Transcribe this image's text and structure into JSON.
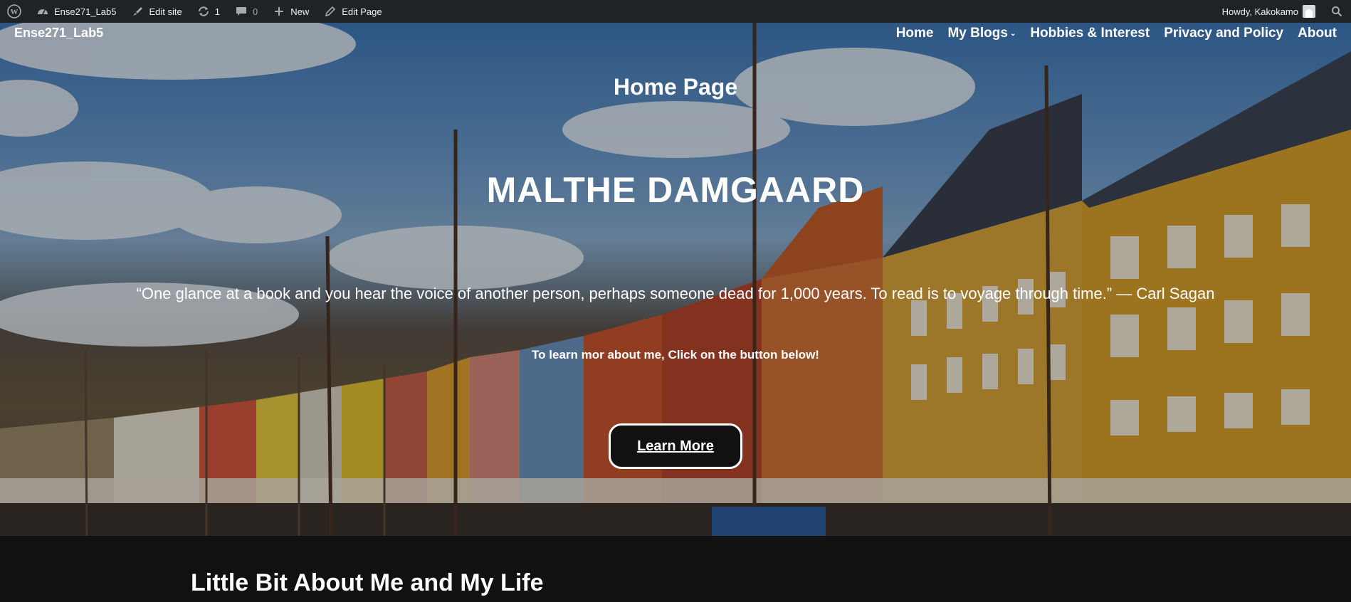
{
  "adminbar": {
    "site_name": "Ense271_Lab5",
    "edit_site": "Edit site",
    "updates_count": "1",
    "comments_count": "0",
    "new_label": "New",
    "edit_page": "Edit Page",
    "howdy": "Howdy, Kakokamo",
    "bg_color": "#1d2327"
  },
  "header": {
    "site_title": "Ense271_Lab5",
    "nav": [
      "Home",
      "My Blogs",
      "Hobbies & Interest",
      "Privacy and Policy",
      "About"
    ]
  },
  "hero": {
    "page_heading": "Home Page",
    "name": "MALTHE DAMGAARD",
    "quote": "“One glance at a book and you hear the voice of another person, perhaps someone dead for 1,000 years. To read is to voyage through time.” — Carl Sagan",
    "learn_text": "To learn mor about me, Click on the button below!",
    "button_label": "Learn More"
  },
  "section": {
    "title": "Little Bit About Me and My Life"
  }
}
